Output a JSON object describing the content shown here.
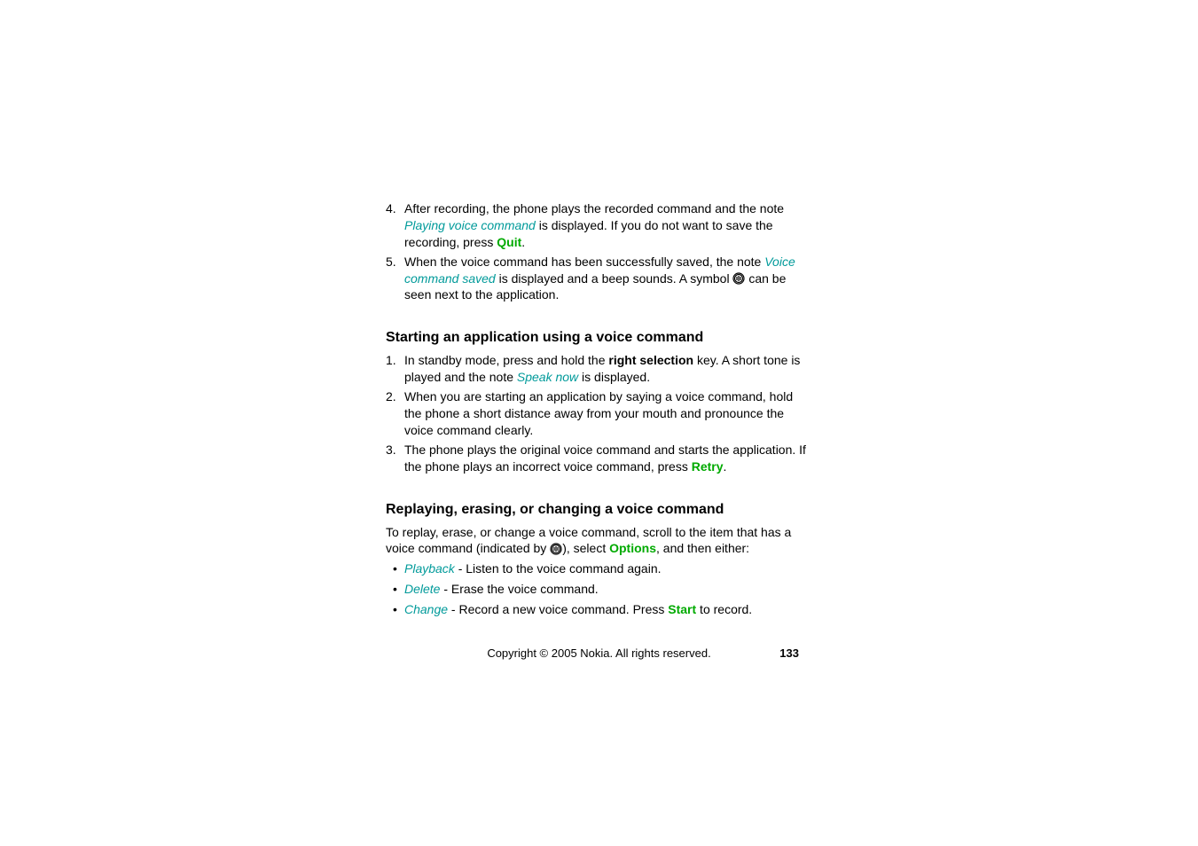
{
  "list4": {
    "num": "4.",
    "t1": "After recording, the phone plays the recorded command and the note ",
    "t2_teal": "Playing voice command",
    "t3": " is displayed. If you do not want to save the recording, press ",
    "t4_green": "Quit",
    "t5": "."
  },
  "list5": {
    "num": "5.",
    "t1": "When the voice command has been successfully saved, the note ",
    "t2_teal": "Voice command saved",
    "t3": " is displayed and a beep sounds. A symbol ",
    "t4": " can be seen next to the application."
  },
  "heading1": "Starting an application using a voice command",
  "start1": {
    "num": "1.",
    "t1": "In standby mode, press and hold the ",
    "t2_bold": "right selection",
    "t3": " key. A short tone is played and the note ",
    "t4_teal": "Speak now",
    "t5": " is displayed."
  },
  "start2": {
    "num": "2.",
    "text": "When you are starting an application by saying a voice command, hold the phone a short distance away from your mouth and pronounce the voice command clearly."
  },
  "start3": {
    "num": "3.",
    "t1": "The phone plays the original voice command and starts the application. If the phone plays an incorrect voice command, press ",
    "t2_green": "Retry",
    "t3": "."
  },
  "heading2": "Replaying, erasing, or changing a voice command",
  "replaypara": {
    "t1": "To replay, erase, or change a voice command, scroll to the item that has a voice command (indicated by ",
    "t2": "), select ",
    "t3_green": "Options",
    "t4": ", and then either:"
  },
  "bullets": {
    "b1_teal": "Playback",
    "b1_rest": " - Listen to the voice command again.",
    "b2_teal": "Delete",
    "b2_rest": " - Erase the voice command.",
    "b3_teal": "Change",
    "b3_rest_a": " - Record a new voice command. Press ",
    "b3_green": "Start",
    "b3_rest_b": " to record."
  },
  "copyright": "Copyright © 2005 Nokia. All rights reserved.",
  "pageNum": "133"
}
